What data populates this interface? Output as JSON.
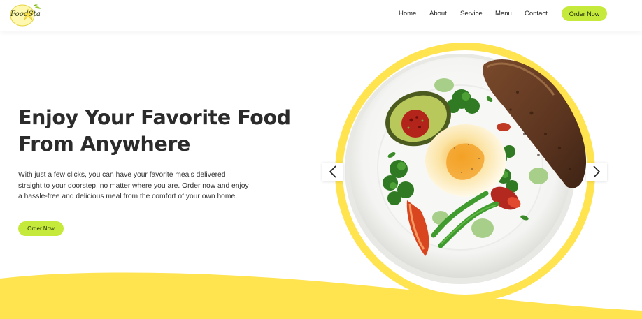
{
  "brand": {
    "logo_text": "FoodSta"
  },
  "nav": {
    "items": [
      {
        "label": "Home"
      },
      {
        "label": "About"
      },
      {
        "label": "Service"
      },
      {
        "label": "Menu"
      },
      {
        "label": "Contact"
      }
    ],
    "cta_label": "Order Now"
  },
  "hero": {
    "title_line1": "Enjoy Your Favorite Food",
    "title_line2": "From Anywhere",
    "description_line1": "With just a few clicks, you can have your favorite meals delivered",
    "description_line2": "straight to your doorstep, no matter where you are. Order now and enjoy",
    "description_line3": "a hassle-free and delicious meal from the comfort of your own home.",
    "cta_label": "Order Now"
  },
  "carousel": {
    "prev_icon": "chevron-left-icon",
    "next_icon": "chevron-right-icon"
  },
  "colors": {
    "accent_green": "#c5ea3b",
    "accent_yellow": "#ffe34f"
  }
}
